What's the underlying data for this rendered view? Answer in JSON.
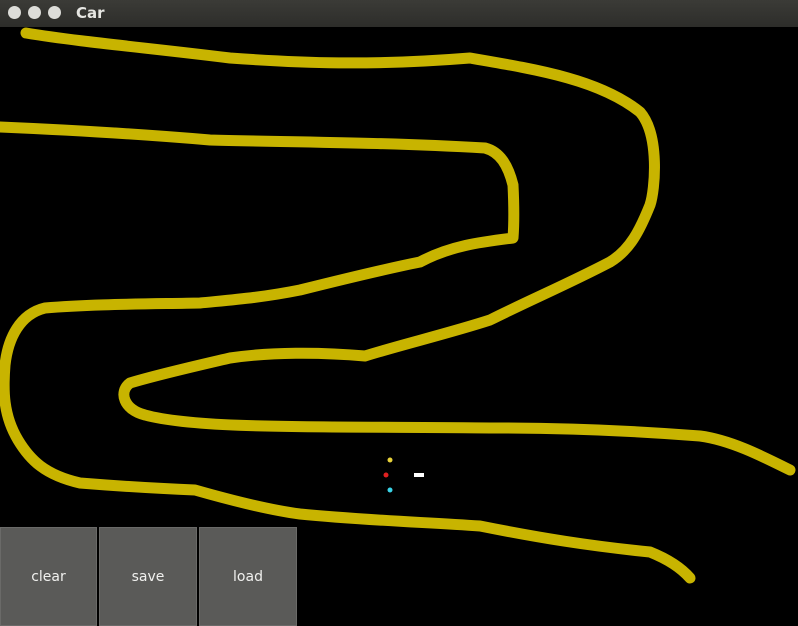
{
  "window": {
    "title": "Car"
  },
  "colors": {
    "track": "#c8b400",
    "background": "#000000",
    "sensor_left": "#e8d23a",
    "sensor_center": "#e02020",
    "sensor_right": "#3ad4e8",
    "car": "#ffffff"
  },
  "buttons": {
    "clear": "clear",
    "save": "save",
    "load": "load"
  }
}
